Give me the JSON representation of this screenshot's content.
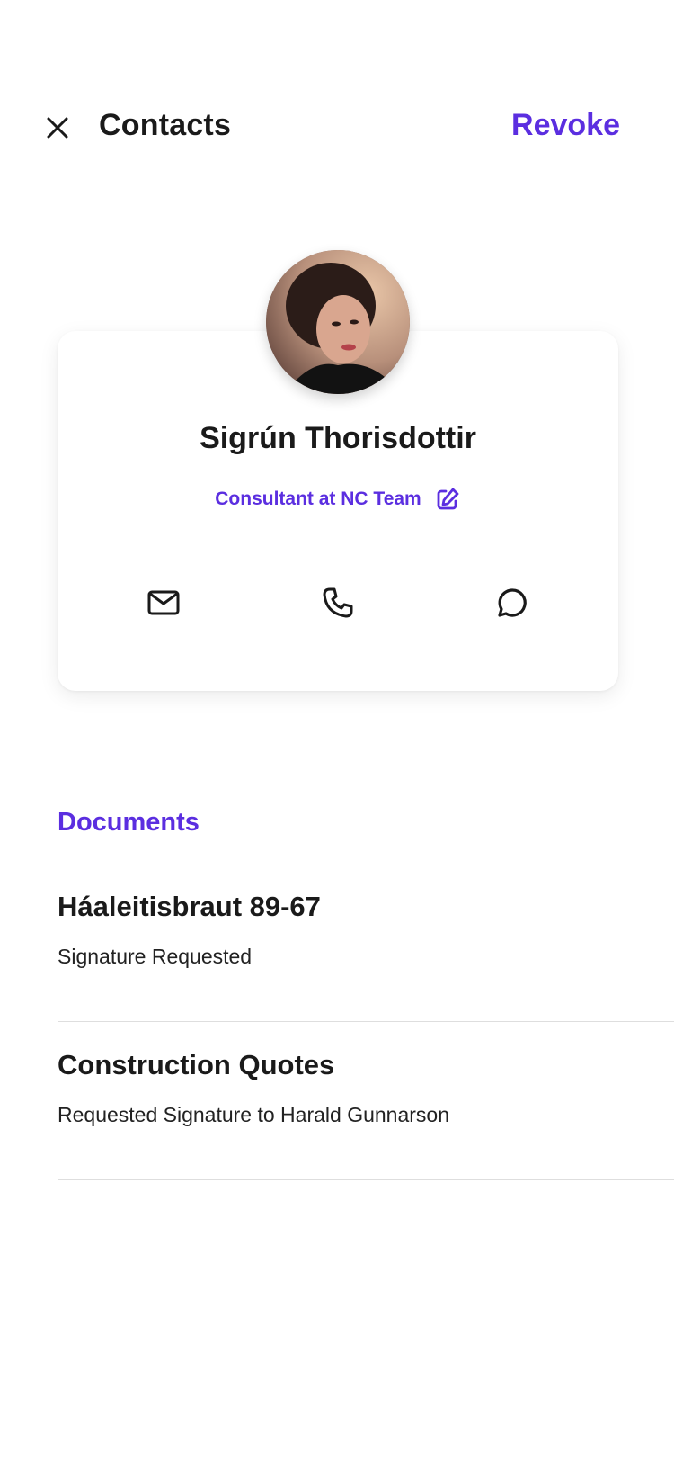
{
  "header": {
    "title": "Contacts",
    "revoke_label": "Revoke",
    "close_icon": "close-icon"
  },
  "contact": {
    "name": "Sigrún Thorisdottir",
    "role": "Consultant at NC Team",
    "avatar": "avatar-photo",
    "actions": [
      "mail-icon",
      "phone-icon",
      "chat-icon"
    ]
  },
  "documents": {
    "title": "Documents",
    "items": [
      {
        "title": "Háaleitisbraut 89-67",
        "subtitle": "Signature Requested"
      },
      {
        "title": "Construction Quotes",
        "subtitle": "Requested Signature to Harald Gunnarson"
      }
    ]
  },
  "colors": {
    "accent": "#5b2ee0",
    "text": "#1a1a1a",
    "divider": "#dedede"
  }
}
